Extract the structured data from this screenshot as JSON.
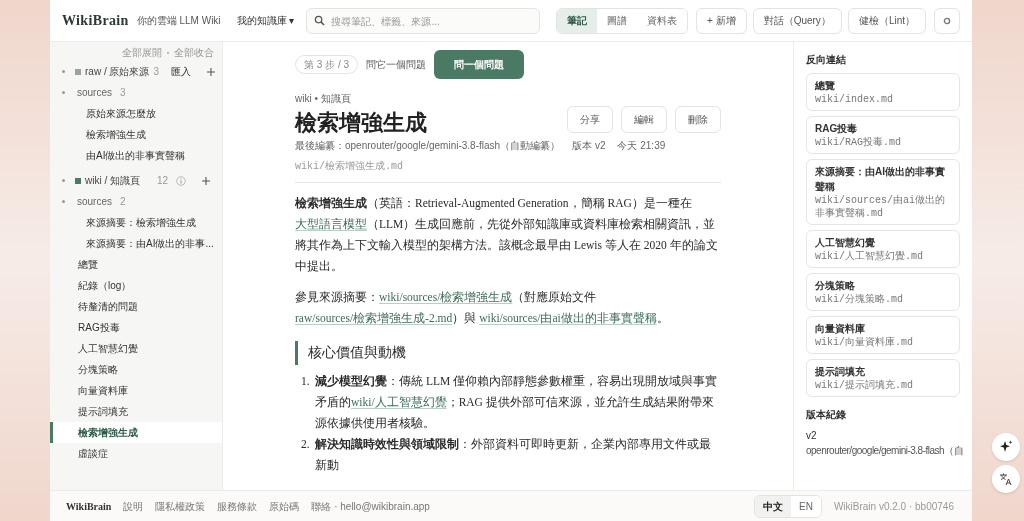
{
  "header": {
    "brand": "WikiBrain",
    "tagline": "你的雲端 LLM Wiki",
    "vault": "我的知識庫 ▾",
    "search": {
      "placeholder": "搜尋筆記、標籤、來源..."
    },
    "views": [
      {
        "label": "筆記",
        "selected": true
      },
      {
        "label": "圖譜",
        "selected": false
      },
      {
        "label": "資料表",
        "selected": false
      }
    ],
    "buttons": [
      "+ 新增",
      "對話（Query）",
      "健檢（Lint）"
    ]
  },
  "sidebar": {
    "expand_all": "全部展開",
    "collapse_all": "全部收合",
    "sections": [
      {
        "label": "raw / 原始來源",
        "color": "#9aa39e",
        "count": "3",
        "action": "匯入",
        "expanded": true,
        "children": [
          {
            "label": "sources",
            "count": "3",
            "expanded": true,
            "children": [
              {
                "label": "原始來源怎麼放",
                "selected": false
              },
              {
                "label": "檢索增強生成",
                "selected": false
              },
              {
                "label": "由AI做出的非事實聲稱",
                "selected": false
              }
            ]
          }
        ]
      },
      {
        "label": "wiki / 知識頁",
        "color": "#4a7a64",
        "count": "12",
        "expanded": true,
        "children": [
          {
            "label": "sources",
            "count": "2",
            "expanded": true,
            "children": [
              {
                "label": "來源摘要：檢索增強生成",
                "selected": false
              },
              {
                "label": "來源摘要：由AI做出的非事...",
                "selected": false
              }
            ]
          },
          {
            "label": "總覽",
            "selected": false
          },
          {
            "label": "紀錄（log）",
            "selected": false
          },
          {
            "label": "待釐清的問題",
            "selected": false
          },
          {
            "label": "RAG投毒",
            "selected": false
          },
          {
            "label": "人工智慧幻覺",
            "selected": false
          },
          {
            "label": "分塊策略",
            "selected": false
          },
          {
            "label": "向量資料庫",
            "selected": false
          },
          {
            "label": "提示詞填充",
            "selected": false
          },
          {
            "label": "檢索增強生成",
            "selected": true
          },
          {
            "label": "虛談症",
            "selected": false
          }
        ]
      }
    ]
  },
  "tour": {
    "step": "第 3 步 / 3",
    "prompt": "問它一個問題",
    "button": "問一個問題"
  },
  "article": {
    "breadcrumb": "wiki • 知識頁",
    "title": "檢索增強生成",
    "actions": [
      "分享",
      "編輯",
      "刪除"
    ],
    "meta": [
      "最後編纂：openrouter/google/gemini-3.8-flash（自動編纂）",
      "版本 v2",
      "今天 21:39"
    ],
    "path": "wiki/檢索增強生成.md",
    "paragraphs": [
      [
        {
          "kind": "bold",
          "text": "檢索增強生成"
        },
        {
          "kind": "text",
          "text": "（英語：Retrieval-Augmented Generation，簡稱 RAG）是一種在"
        },
        {
          "kind": "link",
          "text": "大型語言模型"
        },
        {
          "kind": "text",
          "text": "（LLM）生成回應前，先從外部知識庫或資料庫檢索相關資訊，並將其作為上下文輸入模型的架構方法。該概念最早由 Lewis 等人在 2020 年的論文中提出。"
        }
      ],
      [
        {
          "kind": "text",
          "text": "參見來源摘要："
        },
        {
          "kind": "link",
          "text": "wiki/sources/檢索增強生成"
        },
        {
          "kind": "text",
          "text": "（對應原始文件 "
        },
        {
          "kind": "link",
          "text": "raw/sources/檢索增強生成-2.md"
        },
        {
          "kind": "text",
          "text": "）與 "
        },
        {
          "kind": "link",
          "text": "wiki/sources/由ai做出的非事實聲稱"
        },
        {
          "kind": "text",
          "text": "。"
        }
      ]
    ],
    "heading": "核心價值與動機",
    "list": [
      {
        "number": "1.",
        "runs": [
          {
            "kind": "bold",
            "text": "減少模型幻覺"
          },
          {
            "kind": "text",
            "text": "：傳統 LLM 僅仰賴內部靜態參數權重，容易出現開放域與事實矛盾的"
          },
          {
            "kind": "link",
            "text": "wiki/人工智慧幻覺"
          },
          {
            "kind": "text",
            "text": "；RAG 提供外部可信來源，並允許生成結果附帶來源依據供使用者核驗。"
          }
        ]
      },
      {
        "number": "2.",
        "runs": [
          {
            "kind": "bold",
            "text": "解決知識時效性與領域限制"
          },
          {
            "kind": "text",
            "text": "：外部資料可即時更新，企業內部專用文件或最新動"
          }
        ]
      }
    ]
  },
  "backlinks": {
    "title": "反向連結",
    "items": [
      {
        "title": "總覽",
        "path": "wiki/index.md"
      },
      {
        "title": "RAG投毒",
        "path": "wiki/RAG投毒.md"
      },
      {
        "title": "來源摘要：由AI做出的非事實聲稱",
        "path": "wiki/sources/由ai做出的非事實聲稱.md"
      },
      {
        "title": "人工智慧幻覺",
        "path": "wiki/人工智慧幻覺.md"
      },
      {
        "title": "分塊策略",
        "path": "wiki/分塊策略.md"
      },
      {
        "title": "向量資料庫",
        "path": "wiki/向量資料庫.md"
      },
      {
        "title": "提示詞填充",
        "path": "wiki/提示詞填充.md"
      }
    ]
  },
  "history": {
    "title": "版本紀錄",
    "version": "v2",
    "author": "openrouter/google/gemini-3.8-flash（自"
  },
  "footer": {
    "brand": "WikiBrain",
    "links": [
      "說明",
      "隱私權政策",
      "服務條款",
      "原始碼"
    ],
    "contact": "聯絡 · hello@wikibrain.app",
    "languages": [
      {
        "label": "中文",
        "selected": true
      },
      {
        "label": "EN",
        "selected": false
      }
    ],
    "version": "WikiBrain v0.2.0 · bb00746"
  }
}
